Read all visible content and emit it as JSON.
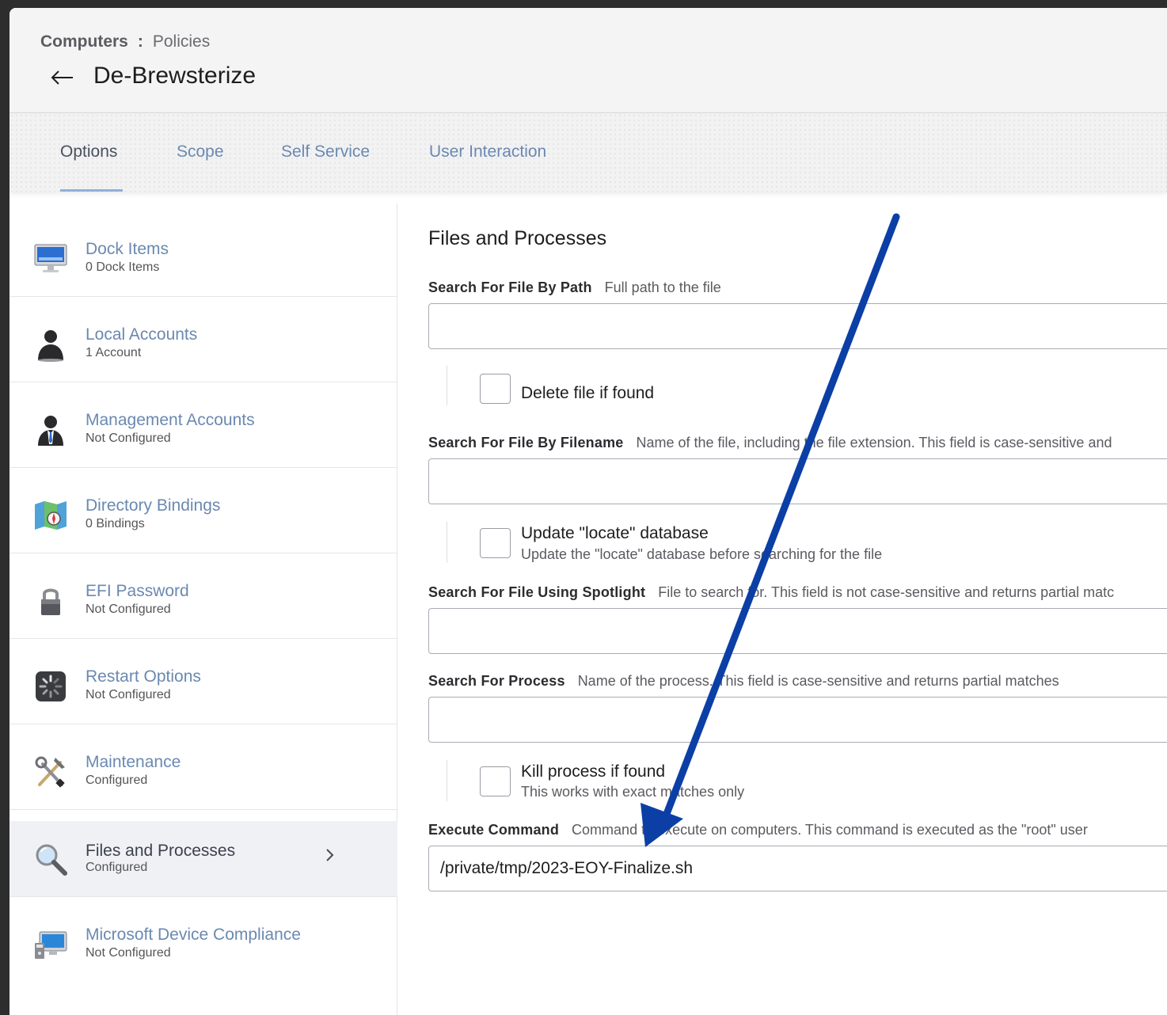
{
  "header": {
    "breadcrumb": {
      "section": "Computers",
      "separator": ":",
      "page": "Policies"
    },
    "title": "De-Brewsterize"
  },
  "tabs": [
    {
      "label": "Options",
      "active": true
    },
    {
      "label": "Scope",
      "active": false
    },
    {
      "label": "Self Service",
      "active": false
    },
    {
      "label": "User Interaction",
      "active": false
    }
  ],
  "sidebar": {
    "items": [
      {
        "label": "Dock Items",
        "status": "0 Dock Items",
        "icon": "monitor-icon"
      },
      {
        "label": "Local Accounts",
        "status": "1 Account",
        "icon": "user-icon"
      },
      {
        "label": "Management Accounts",
        "status": "Not Configured",
        "icon": "admin-user-icon"
      },
      {
        "label": "Directory Bindings",
        "status": "0 Bindings",
        "icon": "map-compass-icon"
      },
      {
        "label": "EFI Password",
        "status": "Not Configured",
        "icon": "lock-icon"
      },
      {
        "label": "Restart Options",
        "status": "Not Configured",
        "icon": "restart-spinner-icon"
      },
      {
        "label": "Maintenance",
        "status": "Configured",
        "icon": "tools-icon"
      },
      {
        "label": "Files and Processes",
        "status": "Configured",
        "icon": "magnifier-icon",
        "selected": true
      },
      {
        "label": "Microsoft Device Compliance",
        "status": "Not Configured",
        "icon": "compliance-icon"
      }
    ]
  },
  "content": {
    "section_title": "Files and Processes",
    "search_by_path": {
      "label": "Search For File By Path",
      "help": "Full path to the file",
      "value": ""
    },
    "delete_file": {
      "label": "Delete file if found",
      "checked": false
    },
    "search_by_filename": {
      "label": "Search For File By Filename",
      "help": "Name of the file, including the file extension. This field is case-sensitive and",
      "value": ""
    },
    "update_locate": {
      "label": "Update \"locate\" database",
      "sub": "Update the \"locate\" database before searching for the file",
      "checked": false
    },
    "search_spotlight": {
      "label": "Search For File Using Spotlight",
      "help": "File to search for. This field is not case-sensitive and returns partial matc",
      "value": ""
    },
    "search_process": {
      "label": "Search For Process",
      "help": "Name of the process. This field is case-sensitive and returns partial matches",
      "value": ""
    },
    "kill_process": {
      "label": "Kill process if found",
      "sub": "This works with exact matches only",
      "checked": false
    },
    "execute_command": {
      "label": "Execute Command",
      "help": "Command to execute on computers. This command is executed as the \"root\" user",
      "value": "/private/tmp/2023-EOY-Finalize.sh"
    }
  },
  "colors": {
    "tab_link": "#6a89b0",
    "annotation_arrow": "#0b3fa6"
  }
}
